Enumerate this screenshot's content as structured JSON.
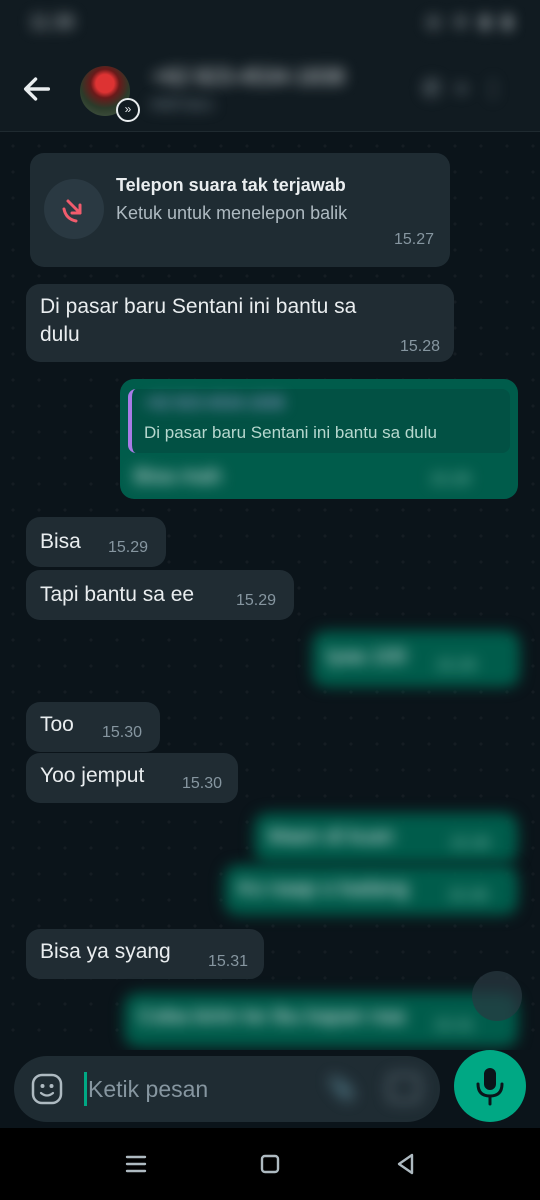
{
  "statusbar": {
    "time": "11.38",
    "icons": "◎ ⊘ ▮ ▮"
  },
  "header": {
    "contact_name": "+62 823-4534-1838",
    "contact_sub": "Aktif baru",
    "icons": [
      "back-arrow-icon",
      "phone-icon",
      "add-call-icon",
      "more-icon"
    ]
  },
  "messages": [
    {
      "type": "missed_call",
      "title": "Telepon suara tak terjawab",
      "subtitle": "Ketuk untuk menelepon balik",
      "time": "15.27"
    },
    {
      "dir": "in",
      "text": "Di pasar baru Sentani ini bantu sa dulu",
      "time": "15.28"
    },
    {
      "dir": "out",
      "quote_sender": "+62 823-4534-1838",
      "quote_text": "Di pasar baru Sentani ini bantu sa dulu",
      "text": "Bisa mah",
      "time": "15.28"
    },
    {
      "dir": "in",
      "text": "Bisa",
      "time": "15.29"
    },
    {
      "dir": "in",
      "text": "Tapi bantu sa ee",
      "time": "15.29"
    },
    {
      "dir": "out",
      "text": "Iyaa 100",
      "time": "15.29"
    },
    {
      "dir": "in",
      "text": "Too",
      "time": "15.30"
    },
    {
      "dir": "in",
      "text": "Yoo jemput",
      "time": "15.30"
    },
    {
      "dir": "out",
      "text": "Maen di kuan",
      "time": "15.30"
    },
    {
      "dir": "out",
      "text": "Ko naap o kadang",
      "time": "15.30"
    },
    {
      "dir": "in",
      "text": "Bisa ya syang",
      "time": "15.31"
    },
    {
      "dir": "out",
      "text": "Coba kirim ke Ibu kapan naa",
      "time": "15.31"
    }
  ],
  "input": {
    "placeholder": "Ketik pesan"
  },
  "navbar": {
    "icons": [
      "recents-icon",
      "home-icon",
      "back-icon"
    ]
  },
  "colors": {
    "background": "#0b141a",
    "incoming": "#202c33",
    "outgoing": "#005c4b",
    "accent": "#00a884"
  }
}
